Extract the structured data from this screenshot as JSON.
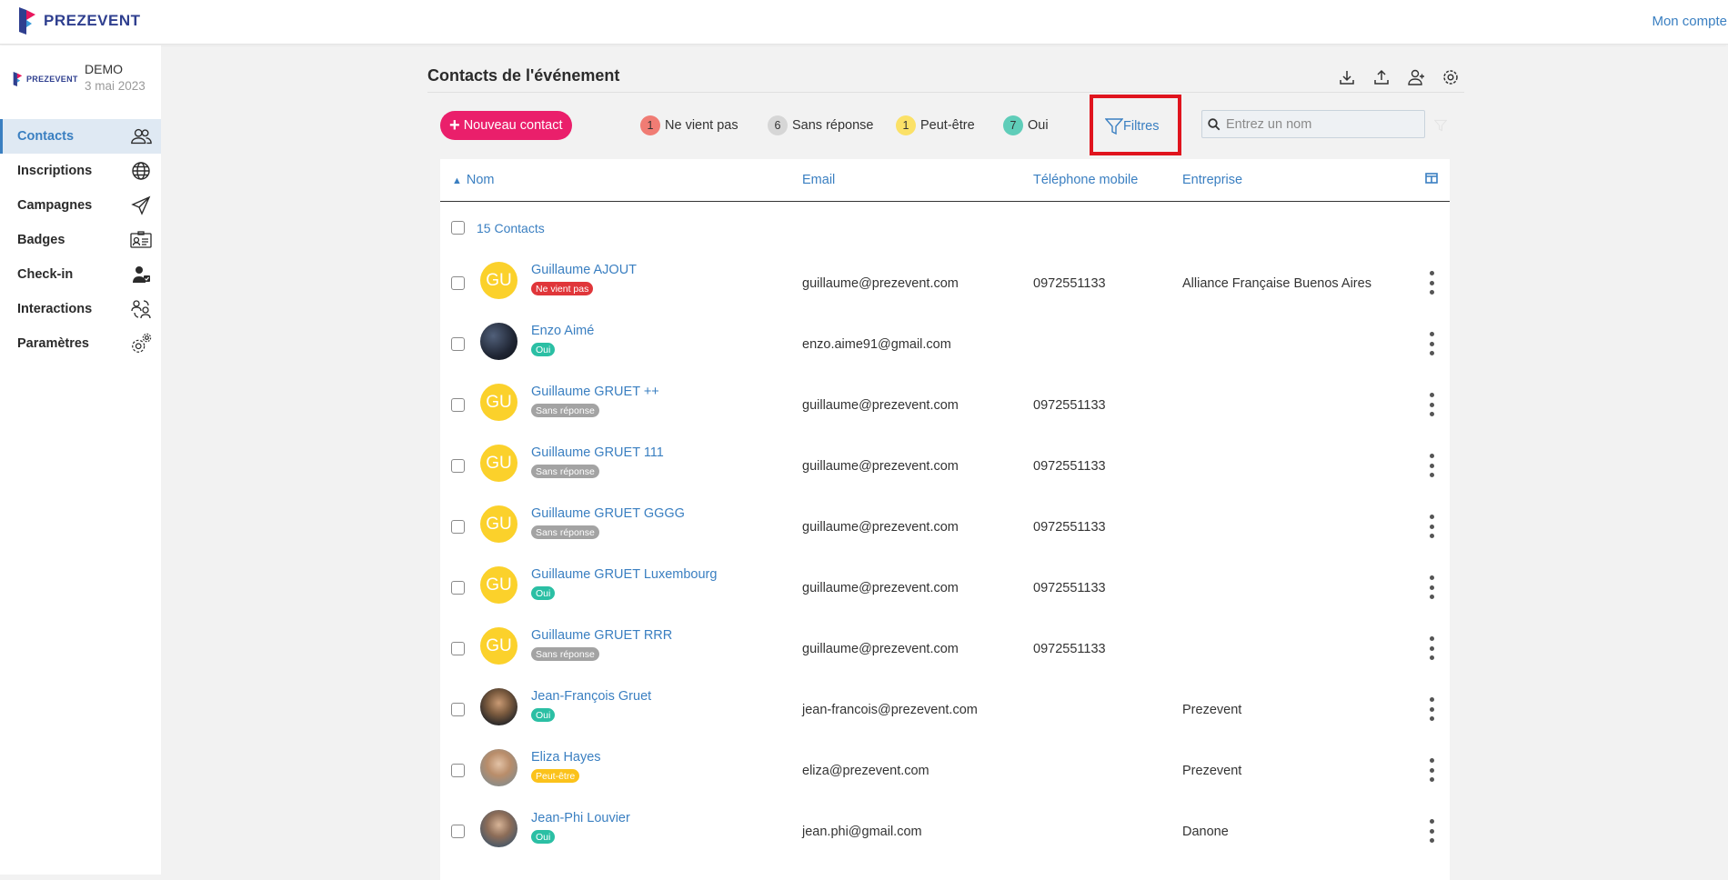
{
  "topbar": {
    "brand": "PREZEVENT",
    "account_link": "Mon compte"
  },
  "sidebar": {
    "event_logo_text": "PREZEVENT",
    "event_name": "DEMO",
    "event_date": "3 mai 2023",
    "items": [
      {
        "label": "Contacts",
        "icon": "contacts-icon",
        "active": true
      },
      {
        "label": "Inscriptions",
        "icon": "globe-icon",
        "active": false
      },
      {
        "label": "Campagnes",
        "icon": "paper-plane-icon",
        "active": false
      },
      {
        "label": "Badges",
        "icon": "badge-card-icon",
        "active": false
      },
      {
        "label": "Check-in",
        "icon": "user-check-icon",
        "active": false
      },
      {
        "label": "Interactions",
        "icon": "interactions-icon",
        "active": false
      },
      {
        "label": "Paramètres",
        "icon": "gears-icon",
        "active": false
      }
    ]
  },
  "header": {
    "title": "Contacts de l'événement",
    "actions": [
      "download-icon",
      "upload-icon",
      "user-group-icon",
      "settings-icon"
    ]
  },
  "toolbar": {
    "new_contact": "Nouveau contact",
    "statuses": [
      {
        "count": "1",
        "label": "Ne vient pas",
        "color": "#f07c74"
      },
      {
        "count": "6",
        "label": "Sans réponse",
        "color": "#d6d6d6"
      },
      {
        "count": "1",
        "label": "Peut-être",
        "color": "#fbe167"
      },
      {
        "count": "7",
        "label": "Oui",
        "color": "#5fcdb9"
      }
    ],
    "filters": "Filtres",
    "search_placeholder": "Entrez un nom"
  },
  "table": {
    "columns": {
      "name": "Nom",
      "email": "Email",
      "phone": "Téléphone mobile",
      "company": "Entreprise"
    },
    "count_label": "15 Contacts",
    "status_colors": {
      "Ne vient pas": "#e0363a",
      "Sans réponse": "#a3a3a3",
      "Oui": "#2bbfa4",
      "Peut-être": "#fbc21b"
    },
    "rows": [
      {
        "initials": "GU",
        "avatar": "initials",
        "name": "Guillaume AJOUT",
        "status": "Ne vient pas",
        "email": "guillaume@prezevent.com",
        "phone": "0972551133",
        "company": "Alliance Française Buenos Aires"
      },
      {
        "initials": "",
        "avatar": "photo-dark",
        "name": "Enzo Aimé",
        "status": "Oui",
        "email": "enzo.aime91@gmail.com",
        "phone": "",
        "company": ""
      },
      {
        "initials": "GU",
        "avatar": "initials",
        "name": "Guillaume GRUET ++",
        "status": "Sans réponse",
        "email": "guillaume@prezevent.com",
        "phone": "0972551133",
        "company": ""
      },
      {
        "initials": "GU",
        "avatar": "initials",
        "name": "Guillaume GRUET 111",
        "status": "Sans réponse",
        "email": "guillaume@prezevent.com",
        "phone": "0972551133",
        "company": ""
      },
      {
        "initials": "GU",
        "avatar": "initials",
        "name": "Guillaume GRUET GGGG",
        "status": "Sans réponse",
        "email": "guillaume@prezevent.com",
        "phone": "0972551133",
        "company": ""
      },
      {
        "initials": "GU",
        "avatar": "initials",
        "name": "Guillaume GRUET Luxembourg",
        "status": "Oui",
        "email": "guillaume@prezevent.com",
        "phone": "0972551133",
        "company": ""
      },
      {
        "initials": "GU",
        "avatar": "initials",
        "name": "Guillaume GRUET RRR",
        "status": "Sans réponse",
        "email": "guillaume@prezevent.com",
        "phone": "0972551133",
        "company": ""
      },
      {
        "initials": "",
        "avatar": "photo-man",
        "name": "Jean-François Gruet",
        "status": "Oui",
        "email": "jean-francois@prezevent.com",
        "phone": "",
        "company": "Prezevent"
      },
      {
        "initials": "",
        "avatar": "photo-woman",
        "name": "Eliza Hayes",
        "status": "Peut-être",
        "email": "eliza@prezevent.com",
        "phone": "",
        "company": "Prezevent"
      },
      {
        "initials": "",
        "avatar": "photo-man2",
        "name": "Jean-Phi Louvier",
        "status": "Oui",
        "email": "jean.phi@gmail.com",
        "phone": "",
        "company": "Danone"
      }
    ]
  }
}
